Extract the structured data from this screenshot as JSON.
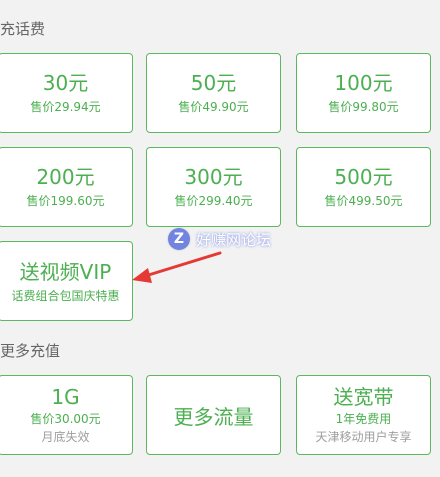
{
  "sections": {
    "recharge_title": "充话费",
    "more_title": "更多充值"
  },
  "recharge_items": [
    {
      "amount": "30元",
      "price": "售价29.94元"
    },
    {
      "amount": "50元",
      "price": "售价49.90元"
    },
    {
      "amount": "100元",
      "price": "售价99.80元"
    },
    {
      "amount": "200元",
      "price": "售价199.60元"
    },
    {
      "amount": "300元",
      "price": "售价299.40元"
    },
    {
      "amount": "500元",
      "price": "售价499.50元"
    }
  ],
  "vip_card": {
    "title": "送视频VIP",
    "subtitle": "话费组合包国庆特惠"
  },
  "more_items": [
    {
      "title": "1G",
      "price": "售价30.00元",
      "note": "月底失效"
    },
    {
      "title": "更多流量"
    },
    {
      "title": "送宽带",
      "line1": "1年免费用",
      "line2": "天津移动用户专享"
    }
  ],
  "watermark": {
    "logo": "Z",
    "text": "好赚网论坛"
  },
  "colors": {
    "accent": "#4caf50",
    "border": "#5cb85c",
    "arrow": "#e53935",
    "muted": "#9e9e9e"
  }
}
